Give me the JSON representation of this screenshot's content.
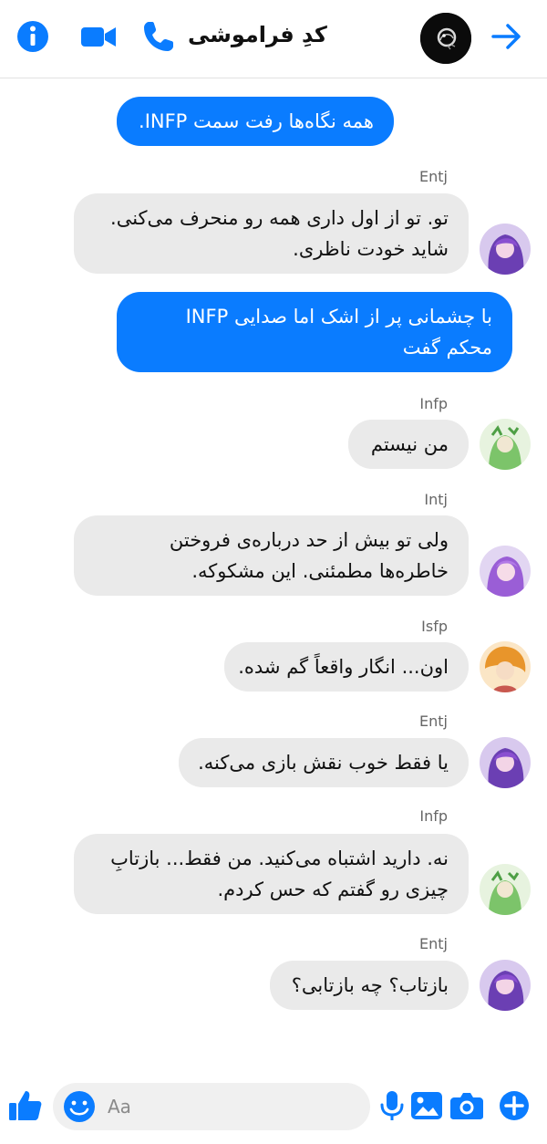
{
  "colors": {
    "accent": "#0a7cff",
    "incoming_bubble": "#eaeaea",
    "outgoing_bubble": "#0a7cff"
  },
  "header": {
    "title": "کدِ فراموشی",
    "icons": [
      "info-icon",
      "video-call-icon",
      "phone-call-icon",
      "forward-arrow-icon"
    ]
  },
  "messages": [
    {
      "direction": "outgoing",
      "lines": [
        "همه نگاه‌ها رفت سمت INFP."
      ]
    },
    {
      "sender": "Entj",
      "lines": [
        "تو. تو از اول داری همه رو منحرف می‌کنی.",
        "شاید خودت ناظری."
      ]
    },
    {
      "direction": "outgoing",
      "lines": [
        "با چشمانی پر از اشک اما صدایی INFP",
        "محکم گفت"
      ]
    },
    {
      "sender": "Infp",
      "lines": [
        "من نیستم"
      ]
    },
    {
      "sender": "Intj",
      "lines": [
        "ولی تو بیش از حد درباره‌ی فروختن",
        "خاطره‌ها مطمئنی. این مشکوکه."
      ]
    },
    {
      "sender": "Isfp",
      "lines": [
        "اون... انگار واقعاً گم شده."
      ]
    },
    {
      "sender": "Entj",
      "lines": [
        "یا فقط خوب نقش بازی می‌کنه."
      ]
    },
    {
      "sender": "Infp",
      "lines": [
        "نه. دارید اشتباه می‌کنید. من فقط... بازتابِ",
        "چیزی رو گفتم که حس کردم."
      ]
    },
    {
      "sender": "Entj",
      "lines": [
        "بازتاب؟ چه بازتابی؟"
      ]
    }
  ],
  "composer": {
    "placeholder": "Aa",
    "icons": [
      "like-icon",
      "emoji-icon",
      "microphone-icon",
      "image-icon",
      "camera-icon",
      "add-icon"
    ]
  }
}
